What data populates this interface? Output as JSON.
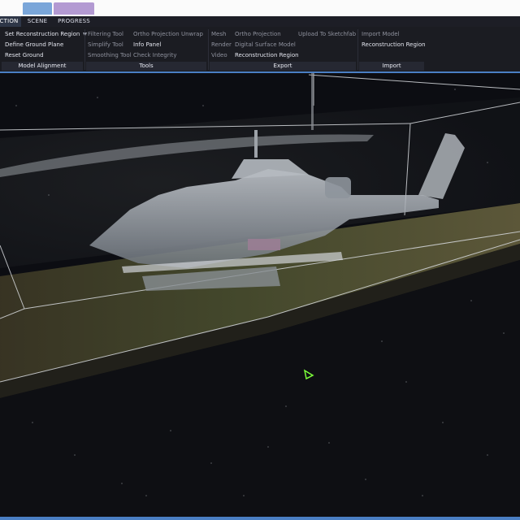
{
  "tabs": [
    {
      "label": "CTION",
      "active": true
    },
    {
      "label": "SCENE",
      "active": false
    },
    {
      "label": "PROGRESS",
      "active": false
    }
  ],
  "ribbon": {
    "model_alignment": {
      "label": "Model Alignment",
      "items": [
        {
          "label": "Set Reconstruction Region",
          "dim": false,
          "dropdown": true
        },
        {
          "label": "Define Ground Plane",
          "dim": false
        },
        {
          "label": "Reset Ground",
          "dim": false
        }
      ]
    },
    "tools": {
      "label": "Tools",
      "items": [
        {
          "label": "Filtering Tool",
          "dim": true
        },
        {
          "label": "Simplify Tool",
          "dim": true
        },
        {
          "label": "Smoothing Tool",
          "dim": true
        },
        {
          "label": "Ortho Projection",
          "dim": true
        },
        {
          "label": "Info Panel",
          "dim": false
        },
        {
          "label": "Check Integrity",
          "dim": true
        },
        {
          "label": "Unwrap",
          "dim": true
        }
      ]
    },
    "export": {
      "label": "Export",
      "items": [
        {
          "label": "Mesh",
          "dim": true
        },
        {
          "label": "Render",
          "dim": true
        },
        {
          "label": "Video",
          "dim": true
        },
        {
          "label": "Ortho Projection",
          "dim": true
        },
        {
          "label": "Digital Surface Model",
          "dim": true
        },
        {
          "label": "Reconstruction Region",
          "dim": false
        },
        {
          "label": "Upload To Sketchfab",
          "dim": true
        }
      ]
    },
    "import": {
      "label": "Import",
      "items": [
        {
          "label": "Import Model",
          "dim": true
        },
        {
          "label": "Reconstruction Region",
          "dim": false
        }
      ]
    }
  },
  "colors": {
    "accent": "#4a7fc4",
    "ribbon_bg": "#1b1c22",
    "viewport_bg": "#0c0d12",
    "camera_marker": "#7cff3a"
  }
}
